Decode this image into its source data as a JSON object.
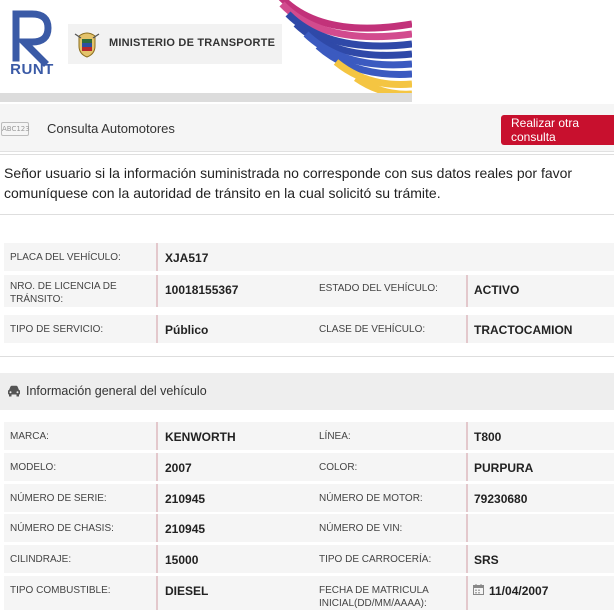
{
  "brand": {
    "logo_text": "RUNT",
    "ministry": "MINISTERIO DE TRANSPORTE"
  },
  "header": {
    "plate_icon_text": "ABC123",
    "title": "Consulta Automotores",
    "action_label": "Realizar otra consulta"
  },
  "notice": "Señor usuario si la información suministrada no corresponde con sus datos reales por favor comuníquese con la autoridad de tránsito en la cual solicitó su trámite.",
  "summary": {
    "placa_label": "PLACA DEL VEHÍCULO:",
    "placa": "XJA517",
    "licencia_label": "NRO. DE LICENCIA DE TRÁNSITO:",
    "licencia": "10018155367",
    "estado_label": "ESTADO DEL VEHÍCULO:",
    "estado": "ACTIVO",
    "servicio_label": "TIPO DE SERVICIO:",
    "servicio": "Público",
    "clase_label": "CLASE DE VEHÍCULO:",
    "clase": "TRACTOCAMION"
  },
  "general": {
    "title": "Información general del vehículo",
    "marca_label": "MARCA:",
    "marca": "KENWORTH",
    "linea_label": "LÍNEA:",
    "linea": "T800",
    "modelo_label": "MODELO:",
    "modelo": "2007",
    "color_label": "COLOR:",
    "color": "PURPURA",
    "serie_label": "NÚMERO DE SERIE:",
    "serie": "210945",
    "motor_label": "NÚMERO DE MOTOR:",
    "motor": "79230680",
    "chasis_label": "NÚMERO DE CHASIS:",
    "chasis": "210945",
    "vin_label": "NÚMERO DE VIN:",
    "vin": "",
    "cilindraje_label": "CILINDRAJE:",
    "cilindraje": "15000",
    "carroceria_label": "TIPO DE CARROCERÍA:",
    "carroceria": "SRS",
    "combustible_label": "TIPO COMBUSTIBLE:",
    "combustible": "DIESEL",
    "matricula_label": "FECHA DE MATRICULA INICIAL(DD/MM/AAAA):",
    "matricula": "11/04/2007"
  },
  "colors": {
    "accent_red": "#c8102e",
    "divider": "#e3c8cc",
    "row_bg": "#f5f5f5",
    "logo_blue": "#3a5aa6"
  }
}
